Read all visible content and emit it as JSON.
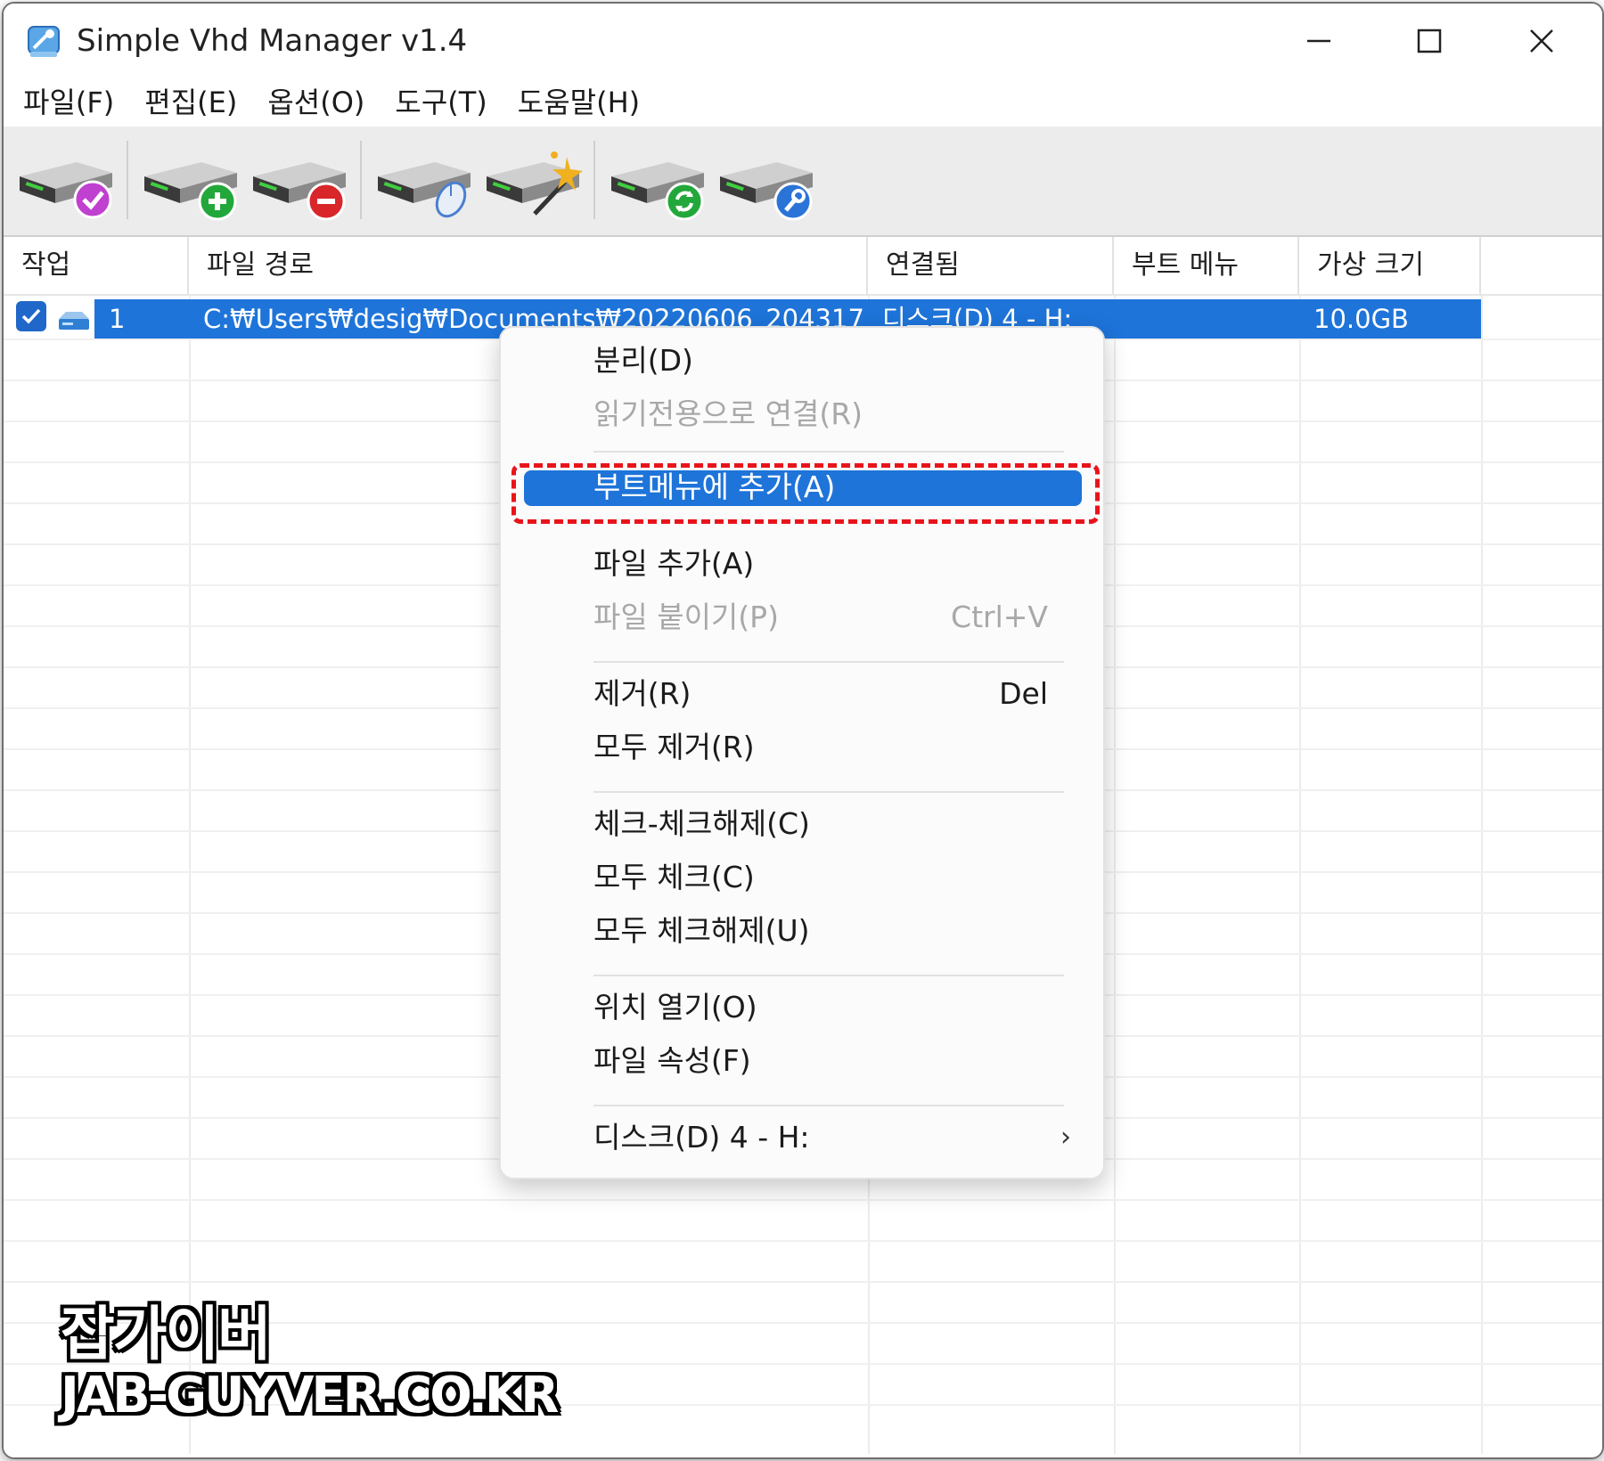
{
  "window": {
    "title": "Simple Vhd Manager v1.4",
    "controls": [
      "minimize",
      "maximize",
      "close"
    ]
  },
  "menubar": {
    "items": [
      "파일(F)",
      "편집(E)",
      "옵션(O)",
      "도구(T)",
      "도움말(H)"
    ]
  },
  "toolbar": {
    "buttons": [
      {
        "icon": "drive-check-icon",
        "badge_color": "#c040d0"
      },
      {
        "icon": "drive-add-icon",
        "badge_color": "#22a83a"
      },
      {
        "icon": "drive-remove-icon",
        "badge_color": "#d8262a"
      },
      {
        "icon": "drive-mouse-icon",
        "badge_color": "#4a7fd0"
      },
      {
        "icon": "drive-wand-icon",
        "badge_color": "#f0b020"
      },
      {
        "icon": "drive-refresh-icon",
        "badge_color": "#22a83a"
      },
      {
        "icon": "drive-wrench-icon",
        "badge_color": "#2a74d8"
      }
    ]
  },
  "table": {
    "columns": [
      "작업",
      "파일 경로",
      "연결됨",
      "부트 메뉴",
      "가상 크기"
    ],
    "rows": [
      {
        "checked": true,
        "task": "1",
        "path": "C:₩Users₩desig₩Documents₩20220606_204317",
        "connected": "디스크(D) 4 - H:",
        "boot_menu": "",
        "size": "10.0GB"
      }
    ],
    "selection_color": "#1e74d9"
  },
  "context_menu": {
    "items": [
      {
        "label": "분리(D)",
        "enabled": true
      },
      {
        "label": "읽기전용으로 연결(R)",
        "enabled": false
      },
      {
        "label": "부트메뉴에 추가(A)",
        "enabled": true,
        "highlighted": true
      },
      {
        "label": "파일 추가(A)",
        "enabled": true
      },
      {
        "label": "파일 붙이기(P)",
        "enabled": false,
        "shortcut": "Ctrl+V"
      },
      {
        "label": "제거(R)",
        "enabled": true,
        "shortcut": "Del"
      },
      {
        "label": "모두 제거(R)",
        "enabled": true
      },
      {
        "label": "체크-체크해제(C)",
        "enabled": true
      },
      {
        "label": "모두 체크(C)",
        "enabled": true
      },
      {
        "label": "모두 체크해제(U)",
        "enabled": true
      },
      {
        "label": "위치 열기(O)",
        "enabled": true
      },
      {
        "label": "파일 속성(F)",
        "enabled": true
      },
      {
        "label": "디스크(D) 4  -  H:",
        "enabled": true,
        "submenu": true,
        "chevron": "›"
      }
    ],
    "highlight_box_color": "#e8141a"
  },
  "watermark": {
    "line1": "잡가이버",
    "line2": "JAB-GUYVER.CO.KR"
  }
}
